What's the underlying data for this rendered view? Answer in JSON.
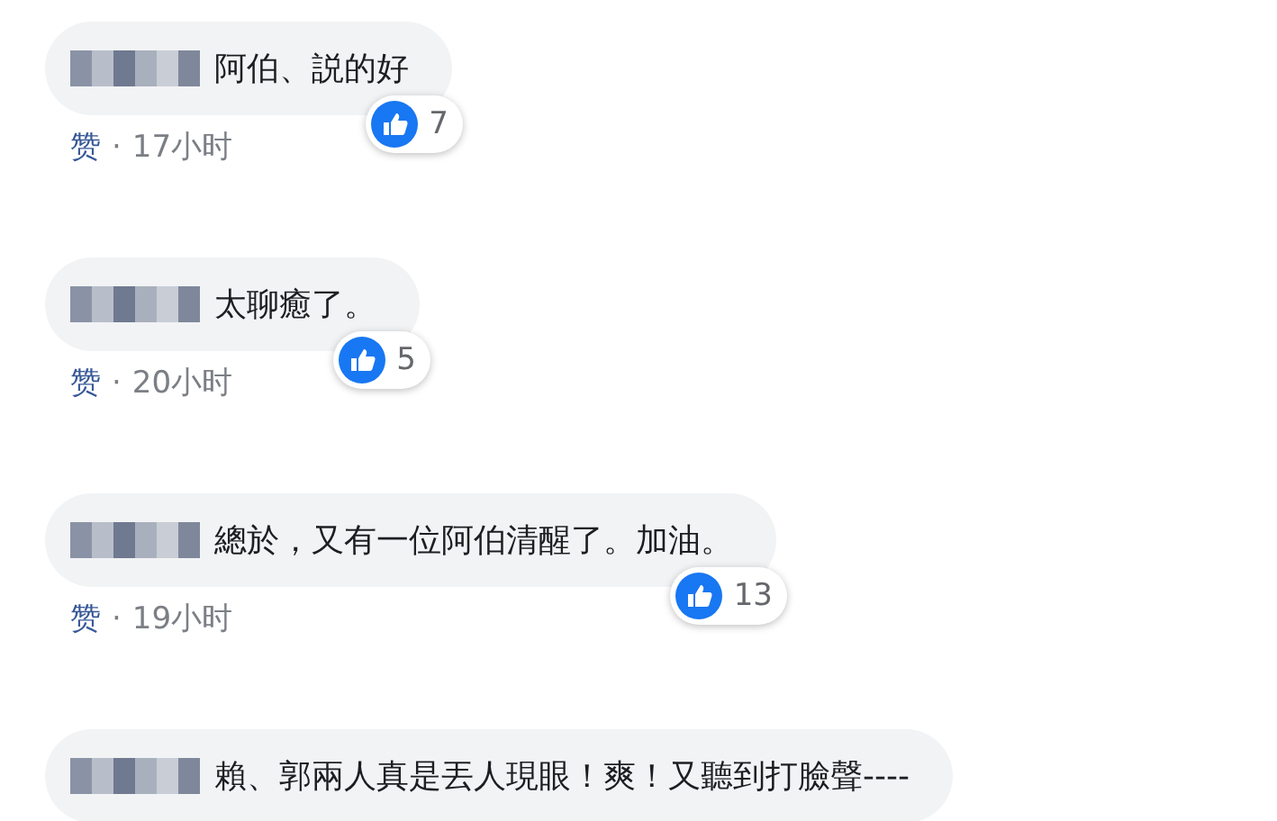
{
  "comments": [
    {
      "text": "阿伯、説的好",
      "reactions": "7",
      "like": "赞",
      "separator": "·",
      "time": "17小时"
    },
    {
      "text": "太聊癒了。",
      "reactions": "5",
      "like": "赞",
      "separator": "·",
      "time": "20小时"
    },
    {
      "text": "總於，又有一位阿伯清醒了。加油。",
      "reactions": "13",
      "like": "赞",
      "separator": "·",
      "time": "19小时"
    },
    {
      "text": "賴、郭兩人真是丟人現眼！爽！又聽到打臉聲----"
    }
  ]
}
